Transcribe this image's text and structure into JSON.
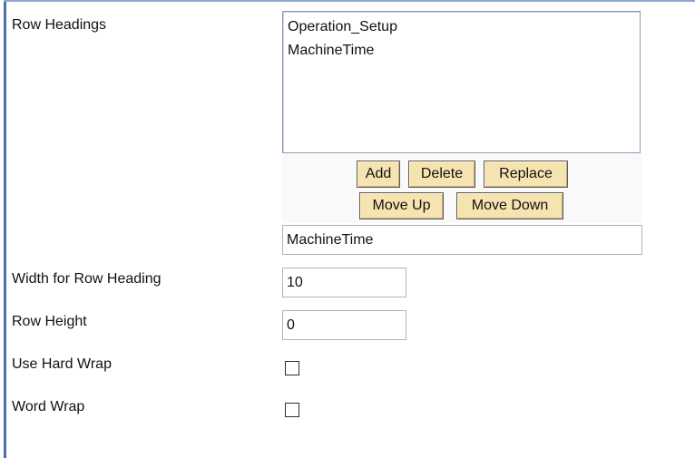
{
  "row_headings": {
    "label": "Row Headings",
    "items": [
      "Operation_Setup",
      "MachineTime"
    ],
    "buttons": {
      "add": "Add",
      "delete": "Delete",
      "replace": "Replace",
      "move_up": "Move Up",
      "move_down": "Move Down"
    },
    "selected_value": "MachineTime"
  },
  "width_for_row_heading": {
    "label": "Width for Row Heading",
    "value": "10"
  },
  "row_height": {
    "label": "Row Height",
    "value": "0"
  },
  "use_hard_wrap": {
    "label": "Use Hard Wrap",
    "checked": false
  },
  "word_wrap": {
    "label": "Word Wrap",
    "checked": false
  },
  "colors": {
    "button_face": "#f6e4b0",
    "border_accent": "#4d6fa8"
  }
}
